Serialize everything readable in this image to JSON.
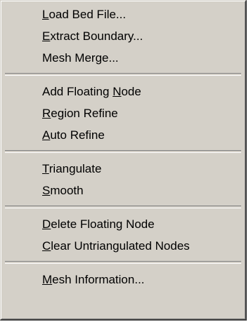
{
  "menu": {
    "groups": [
      {
        "items": [
          {
            "pre": "",
            "key": "L",
            "post": "oad Bed File..."
          },
          {
            "pre": "",
            "key": "E",
            "post": "xtract Boundary..."
          },
          {
            "pre": "Mesh Merge...",
            "key": "",
            "post": ""
          }
        ]
      },
      {
        "items": [
          {
            "pre": "Add Floating ",
            "key": "N",
            "post": "ode"
          },
          {
            "pre": "",
            "key": "R",
            "post": "egion Refine"
          },
          {
            "pre": "",
            "key": "A",
            "post": "uto Refine"
          }
        ]
      },
      {
        "items": [
          {
            "pre": "",
            "key": "T",
            "post": "riangulate"
          },
          {
            "pre": "",
            "key": "S",
            "post": "mooth"
          }
        ]
      },
      {
        "items": [
          {
            "pre": "",
            "key": "D",
            "post": "elete Floating Node"
          },
          {
            "pre": "",
            "key": "C",
            "post": "lear Untriangulated Nodes"
          }
        ]
      },
      {
        "items": [
          {
            "pre": "",
            "key": "M",
            "post": "esh Information..."
          }
        ]
      }
    ]
  }
}
